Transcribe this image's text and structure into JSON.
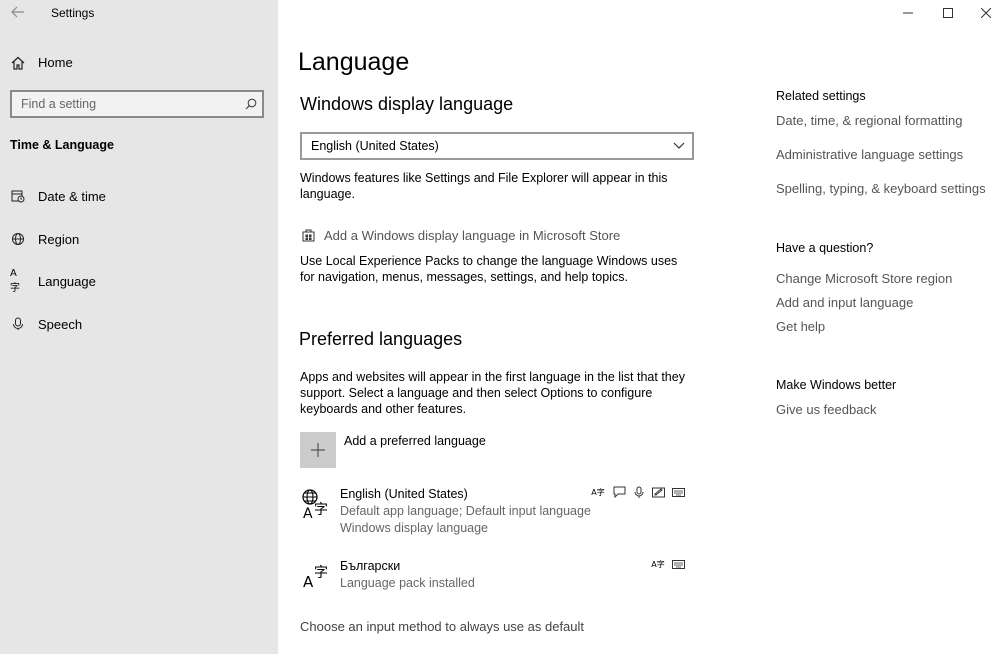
{
  "window": {
    "title": "Settings",
    "back_icon": "back-arrow-icon",
    "minimize_icon": "minimize-icon",
    "maximize_icon": "maximize-icon",
    "close_icon": "close-icon"
  },
  "sidebar": {
    "home_label": "Home",
    "search_placeholder": "Find a setting",
    "section_title": "Time & Language",
    "items": [
      {
        "label": "Date & time",
        "icon": "calendar-clock-icon"
      },
      {
        "label": "Region",
        "icon": "globe-icon"
      },
      {
        "label": "Language",
        "icon": "language-icon"
      },
      {
        "label": "Speech",
        "icon": "microphone-icon"
      }
    ]
  },
  "main": {
    "page_title": "Language",
    "display_language": {
      "heading": "Windows display language",
      "selected": "English (United States)",
      "description": "Windows features like Settings and File Explorer will appear in this language.",
      "store_link": "Add a Windows display language in Microsoft Store",
      "store_description": "Use Local Experience Packs to change the language Windows uses for navigation, menus, messages, settings, and help topics."
    },
    "preferred": {
      "heading": "Preferred languages",
      "description": "Apps and websites will appear in the first language in the list that they support. Select a language and then select Options to configure keyboards and other features.",
      "add_label": "Add a preferred language",
      "languages": [
        {
          "name": "English (United States)",
          "line1": "Default app language; Default input language",
          "line2": "Windows display language",
          "features": [
            "display-language-icon",
            "text-to-speech-icon",
            "speech-recognition-icon",
            "handwriting-icon",
            "keyboard-icon"
          ]
        },
        {
          "name": "Български",
          "line1": "Language pack installed",
          "features": [
            "display-language-icon",
            "keyboard-icon"
          ]
        }
      ],
      "input_method_link": "Choose an input method to always use as default"
    }
  },
  "right_panel": {
    "related_heading": "Related settings",
    "related_links": [
      "Date, time, & regional formatting",
      "Administrative language settings",
      "Spelling, typing, & keyboard settings"
    ],
    "question_heading": "Have a question?",
    "question_links": [
      "Change Microsoft Store region",
      "Add and input language",
      "Get help"
    ],
    "better_heading": "Make Windows better",
    "feedback_link": "Give us feedback"
  }
}
